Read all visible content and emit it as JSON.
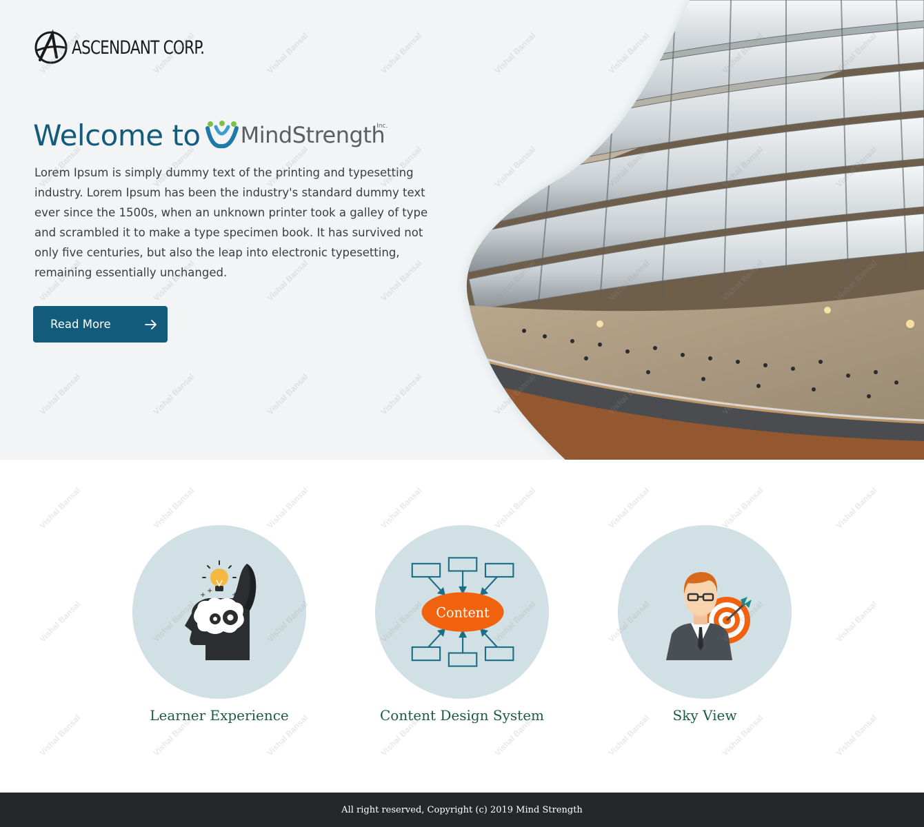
{
  "header": {
    "logo_text": "ASCENDANT CORP."
  },
  "hero": {
    "welcome_text": "Welcome to",
    "brand_name": "MindStrength",
    "brand_suffix": "Inc.",
    "intro": "Lorem Ipsum is simply dummy text of the printing and typesetting industry. Lorem Ipsum has been the industry's standard dummy text ever since the 1500s, when an unknown printer took a galley of type and scrambled it to make a type specimen book. It has survived not only five centuries, but also the leap into electronic typesetting, remaining essentially unchanged.",
    "button_label": "Read More"
  },
  "features": [
    {
      "label": "Learner Experience",
      "icon": "head-lightbulb-icon"
    },
    {
      "label": "Content Design System",
      "icon": "content-diagram-icon",
      "icon_text": "Content"
    },
    {
      "label": "Sky View",
      "icon": "businessman-target-icon"
    }
  ],
  "watermark": "Vishal Bansal",
  "footer": {
    "copyright": "All right reserved, Copyright (c) 2019 Mind Strength"
  },
  "colors": {
    "primary": "#135b7b",
    "feature_circle": "#d1e0e5",
    "feature_label": "#1c5a43",
    "footer_bg": "#25272b",
    "hero_bg": "#f3f4f6",
    "accent_orange": "#f0620e"
  }
}
